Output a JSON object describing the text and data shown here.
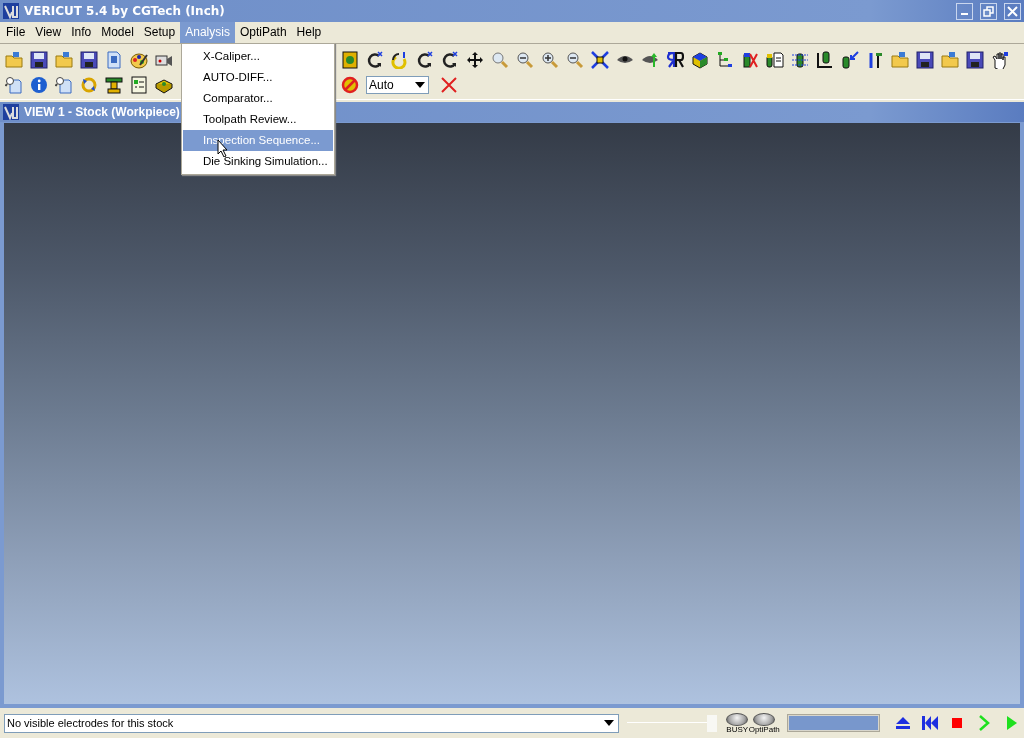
{
  "window": {
    "title": "VERICUT 5.4 by CGTech (Inch)"
  },
  "menu_bar": [
    {
      "label": "File",
      "selected": false
    },
    {
      "label": "View",
      "selected": false
    },
    {
      "label": "Info",
      "selected": false
    },
    {
      "label": "Model",
      "selected": false
    },
    {
      "label": "Setup",
      "selected": false
    },
    {
      "label": "Analysis",
      "selected": true
    },
    {
      "label": "OptiPath",
      "selected": false
    },
    {
      "label": "Help",
      "selected": false
    }
  ],
  "analysis_menu": [
    {
      "label": "X-Caliper...",
      "selected": false
    },
    {
      "label": "AUTO-DIFF...",
      "selected": false
    },
    {
      "label": "Comparator...",
      "selected": false
    },
    {
      "label": "Toolpath Review...",
      "selected": false
    },
    {
      "label": "Inspection Sequence...",
      "selected": true
    },
    {
      "label": "Die Sinking Simulation...",
      "selected": false
    }
  ],
  "toolbar": {
    "view_combo": "Auto"
  },
  "view": {
    "title": "VIEW 1 - Stock (Workpiece)"
  },
  "status_bar": {
    "message": "No visible electrodes for this stock",
    "speed_slider": {
      "level": 1
    },
    "lights": [
      {
        "label": "BUSY",
        "on": false
      },
      {
        "label": "OptiPath",
        "on": false
      }
    ],
    "progress": {
      "level": 1
    }
  }
}
